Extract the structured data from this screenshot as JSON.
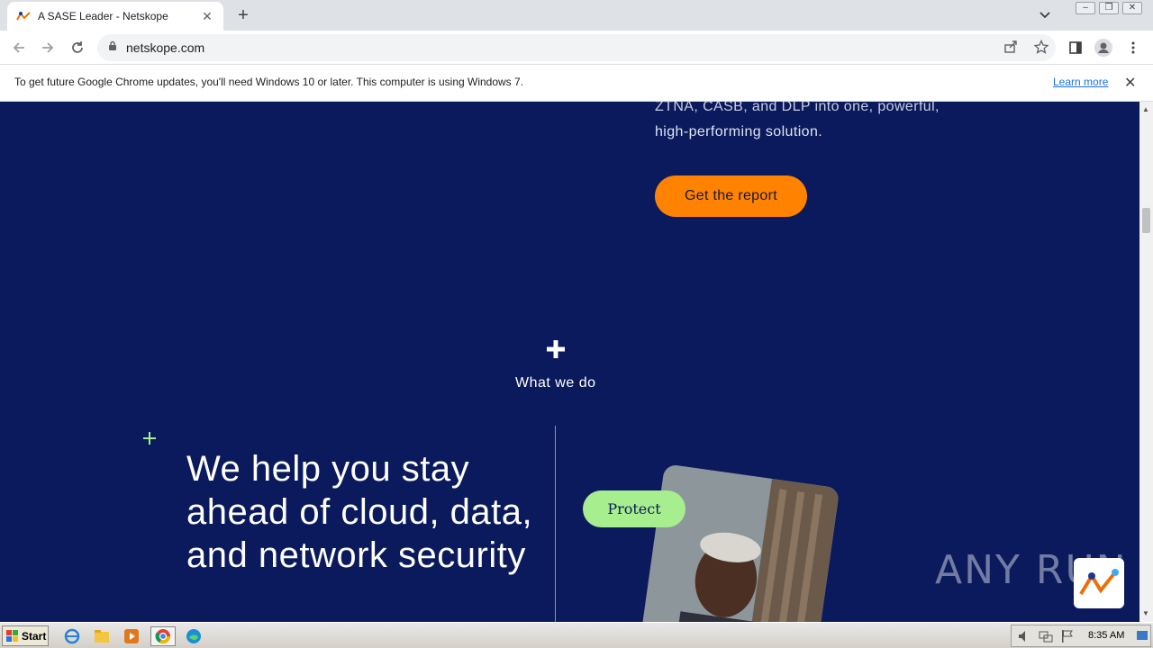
{
  "browser": {
    "tab_title": "A SASE Leader - Netskope",
    "url": "netskope.com"
  },
  "infobar": {
    "message": "To get future Google Chrome updates, you'll need Windows 10 or later. This computer is using Windows 7.",
    "learn_more": "Learn more"
  },
  "hero": {
    "text_cut": "ZTNA, CASB, and DLP into one, powerful,",
    "text_line": "high-performing solution.",
    "cta": "Get the report"
  },
  "section": {
    "label": "What we do",
    "headline": "We help you stay ahead of cloud, data, and network security",
    "badge": "Protect"
  },
  "watermark": "ANY RUN",
  "taskbar": {
    "start": "Start",
    "clock": "8:35 AM"
  },
  "colors": {
    "page_bg": "#0b1a5c",
    "cta_orange": "#ff8300",
    "badge_green": "#a7ee8e"
  }
}
